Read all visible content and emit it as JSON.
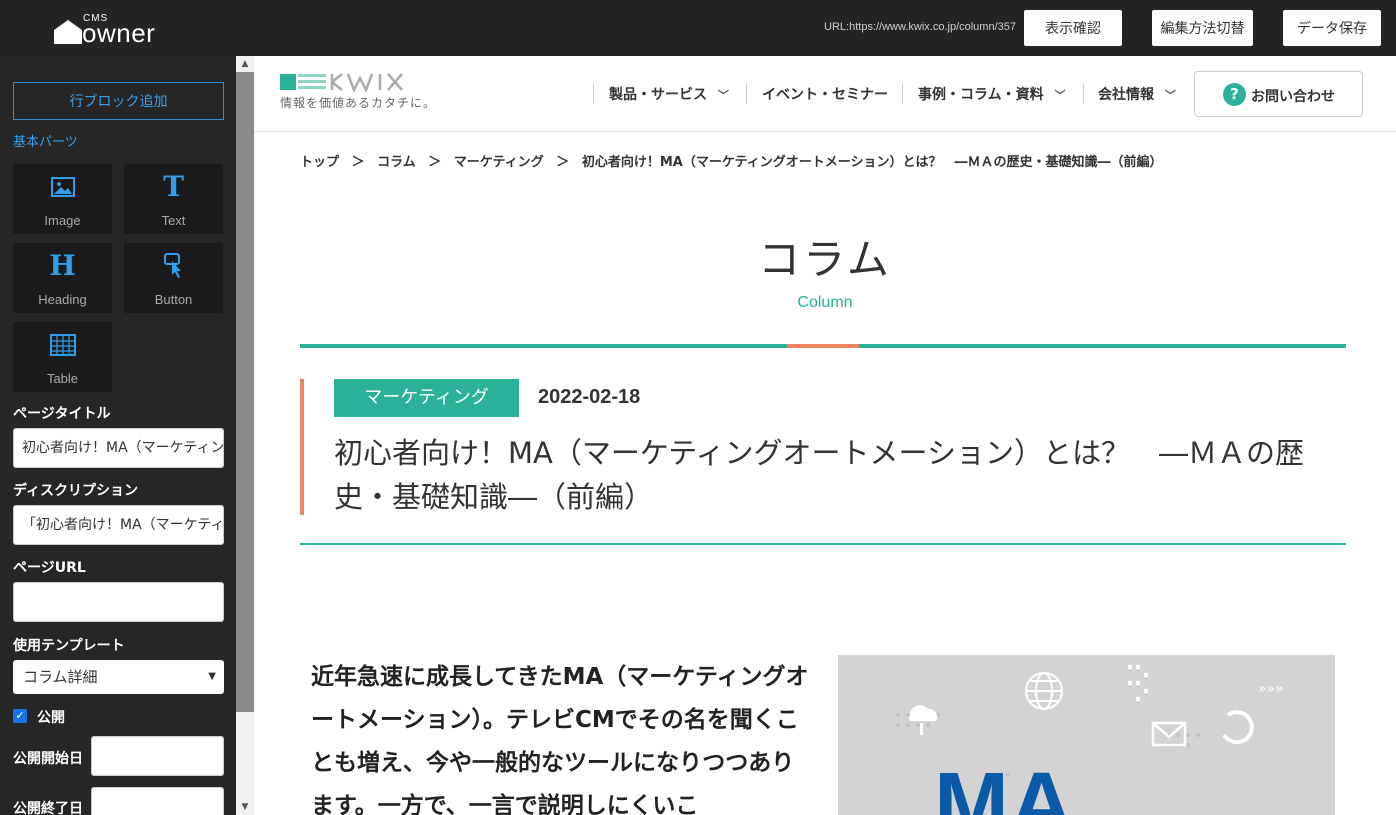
{
  "topbar": {
    "logo_small": "CMS",
    "logo_big": "owner",
    "url": "URL:https://www.kwix.co.jp/column/357",
    "buttons": [
      "表示確認",
      "編集方法切替",
      "データ保存"
    ]
  },
  "panel": {
    "add_block": "行ブロック追加",
    "basic_parts_label": "基本パーツ",
    "parts": [
      {
        "label": "Image",
        "icon": "image-icon"
      },
      {
        "label": "Text",
        "icon": "text-icon"
      },
      {
        "label": "Heading",
        "icon": "heading-icon"
      },
      {
        "label": "Button",
        "icon": "button-icon"
      },
      {
        "label": "Table",
        "icon": "table-icon"
      }
    ],
    "page_title_label": "ページタイトル",
    "page_title_value": "初心者向け！MA（マーケティングオートメーション）とは？",
    "description_label": "ディスクリプション",
    "description_value": "「初心者向け！MA（マーケティングオートメーション）",
    "page_url_label": "ページURL",
    "page_url_value": "",
    "template_label": "使用テンプレート",
    "template_value": "コラム詳細",
    "publish_label": "公開",
    "publish_checked": true,
    "start_label": "公開開始日",
    "end_label": "公開終了日"
  },
  "site": {
    "tagline": "情報を価値あるカタチに。",
    "nav": [
      "製品・サービス",
      "イベント・セミナー",
      "事例・コラム・資料",
      "会社情報"
    ],
    "contact": "お問い合わせ",
    "breadcrumbs": [
      "トップ",
      "＞",
      "コラム",
      "＞",
      "マーケティング",
      "＞",
      "初心者向け！MA（マーケティングオートメーション）とは？　―ＭＡの歴史・基礎知識―（前編）"
    ],
    "section_title": "コラム",
    "section_sub": "Column",
    "category": "マーケティング",
    "date": "2022-02-18",
    "title": "初心者向け！MA（マーケティングオートメーション）とは？　―ＭＡの歴史・基礎知識―（前編）",
    "lead": "近年急速に成長してきたMA（マーケティングオートメーション）。テレビCMでその名を聞くことも増え、今や一般的なツールになりつつあります。一方で、一言で説明しにくいこ",
    "hero_text": "MA"
  },
  "colors": {
    "accent_green": "#2ab197",
    "accent_orange": "#f08461",
    "topbar_bg": "#242424"
  }
}
